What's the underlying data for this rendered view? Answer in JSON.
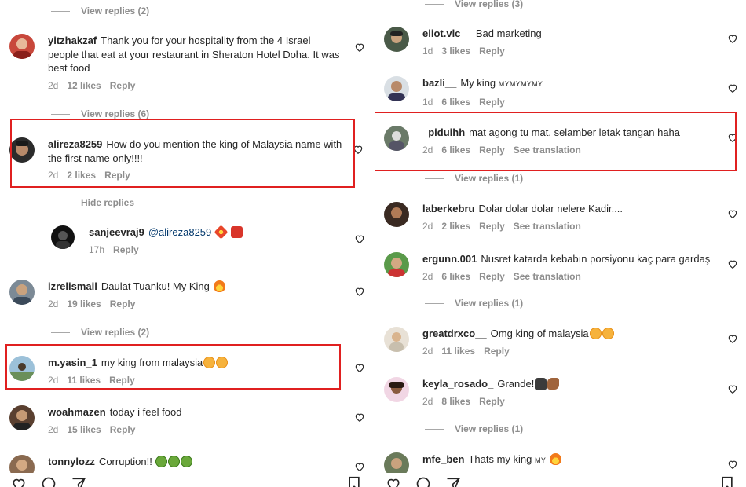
{
  "left": {
    "vr0": "View replies (2)",
    "c_yitzhak": {
      "user": "yitzhakzaf",
      "text": "Thank you for your hospitality from the 4 Israel people that eat at your restaurant in Sheraton Hotel Doha. It was best food",
      "time": "2d",
      "likes": "12 likes",
      "reply": "Reply"
    },
    "vr1": "View replies (6)",
    "c_alireza": {
      "user": "alireza8259",
      "text": "How do you mention the king of Malaysia name with the first name only!!!!",
      "time": "2d",
      "likes": "2 likes",
      "reply": "Reply"
    },
    "hide": "Hide replies",
    "c_sanjeev": {
      "user": "sanjeevraj9",
      "mention": "@alireza8259",
      "time": "17h",
      "reply": "Reply"
    },
    "c_izrel": {
      "user": "izrelismail",
      "text": "Daulat Tuanku! My King",
      "time": "2d",
      "likes": "19 likes",
      "reply": "Reply"
    },
    "vr2": "View replies (2)",
    "c_yasin": {
      "user": "m.yasin_1",
      "text": "my king from malaysia",
      "time": "2d",
      "likes": "11 likes",
      "reply": "Reply"
    },
    "c_woah": {
      "user": "woahmazen",
      "text": "today i feel food",
      "time": "2d",
      "likes": "15 likes",
      "reply": "Reply"
    },
    "c_tonny": {
      "user": "tonnylozz",
      "text": "Corruption!!"
    }
  },
  "right": {
    "vr0": "View replies (3)",
    "c_eliot": {
      "user": "eliot.vlc__",
      "text": "Bad marketing",
      "time": "1d",
      "likes": "3 likes",
      "reply": "Reply"
    },
    "c_bazli": {
      "user": "bazli__",
      "text": "My king",
      "suffix": "MYMYMYMY",
      "time": "1d",
      "likes": "6 likes",
      "reply": "Reply"
    },
    "c_piduihh": {
      "user": "_piduihh",
      "text": "mat agong tu mat, selamber letak tangan haha",
      "time": "2d",
      "likes": "6 likes",
      "reply": "Reply",
      "translate": "See translation"
    },
    "vr1": "View replies (1)",
    "c_laber": {
      "user": "laberkebru",
      "text": "Dolar dolar dolar nelere Kadir....",
      "time": "2d",
      "likes": "2 likes",
      "reply": "Reply",
      "translate": "See translation"
    },
    "c_ergunn": {
      "user": "ergunn.001",
      "text": "Nusret katarda kebabın porsiyonu kaç para gardaş",
      "time": "2d",
      "likes": "6 likes",
      "reply": "Reply",
      "translate": "See translation"
    },
    "vr2": "View replies (1)",
    "c_great": {
      "user": "greatdrxco__",
      "text": "Omg king of malaysia",
      "time": "2d",
      "likes": "11 likes",
      "reply": "Reply"
    },
    "c_keyla": {
      "user": "keyla_rosado_",
      "text": "Grande!",
      "time": "2d",
      "likes": "8 likes",
      "reply": "Reply"
    },
    "vr3": "View replies (1)",
    "c_mfe": {
      "user": "mfe_ben",
      "text": "Thats my king",
      "suffix": "MY"
    }
  },
  "colors": {
    "highlight": "#e02020",
    "meta": "#8e8e8e",
    "mention": "#00376b"
  },
  "icons": [
    "heart-icon",
    "comment-icon",
    "share-icon",
    "bookmark-icon"
  ]
}
